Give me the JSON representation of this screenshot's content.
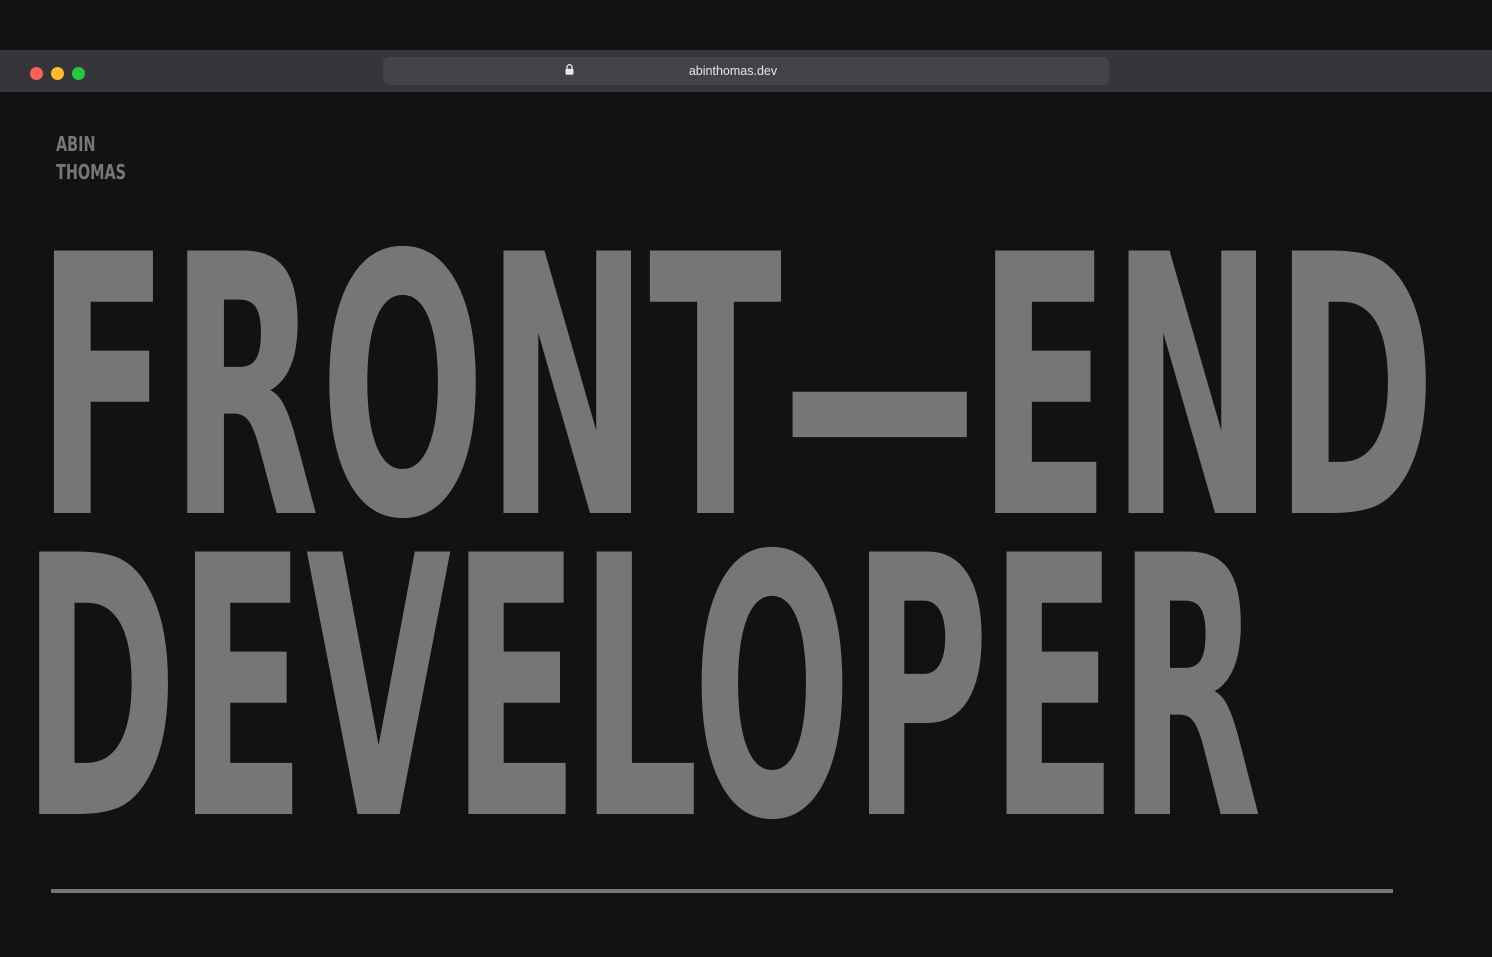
{
  "browser": {
    "url": "abinthomas.dev",
    "lock_icon": "lock-icon"
  },
  "site": {
    "logo_line1": "ABIN",
    "logo_line2": "THOMAS",
    "hero_line1": "FRONT—END",
    "hero_line2": "DEVELOPER"
  },
  "colors": {
    "background": "#121212",
    "text": "#767676",
    "browser_bar": "#35353a",
    "url_field": "#424248"
  }
}
